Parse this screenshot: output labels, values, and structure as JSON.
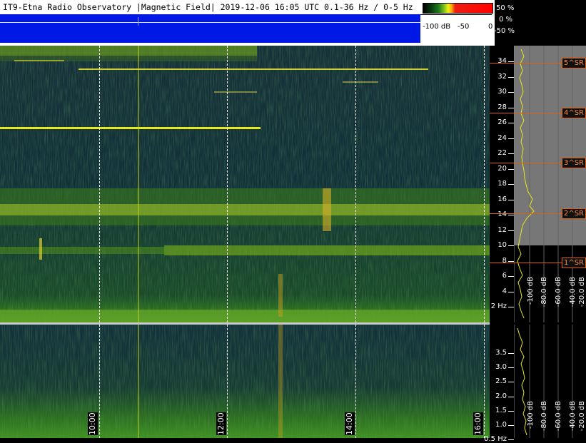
{
  "header": {
    "title": "IT9-Etna Radio Observatory |Magnetic Field| 2019-12-06 16:05 UTC 0.1-36 Hz / 0-5 Hz"
  },
  "colorbar": {
    "left_label": "-100 dB",
    "mid_label": "-50",
    "right_label": "0",
    "pct_top": "50 %",
    "pct_mid": "0 %",
    "pct_bot": "-50 %"
  },
  "spectrogram_top": {
    "freq_ticks": [
      "34",
      "32",
      "30",
      "28",
      "26",
      "24",
      "22",
      "20",
      "18",
      "16",
      "14",
      "12",
      "10",
      "8",
      "6",
      "4",
      "2 Hz"
    ]
  },
  "spectrogram_bottom": {
    "freq_ticks": [
      "3.5",
      "3.0",
      "2.5",
      "2.0",
      "1.5",
      "1.0",
      "0.5 Hz"
    ]
  },
  "time_axis": {
    "labels": [
      "10:00",
      "12:00",
      "14:00",
      "16:00"
    ]
  },
  "schumann": {
    "labels": [
      "5^SR",
      "4^SR",
      "3^SR",
      "2^SR",
      "1^SR"
    ]
  },
  "db_scale": {
    "labels": [
      "-100 dB",
      "-80.0 dB",
      "-60.0 dB",
      "-40.0 dB",
      "-20.0 dB"
    ]
  },
  "colors": {
    "band_blue": "#0018e6",
    "sr_orange": "#e06010",
    "spectrum_yellow": "#e8e820"
  }
}
